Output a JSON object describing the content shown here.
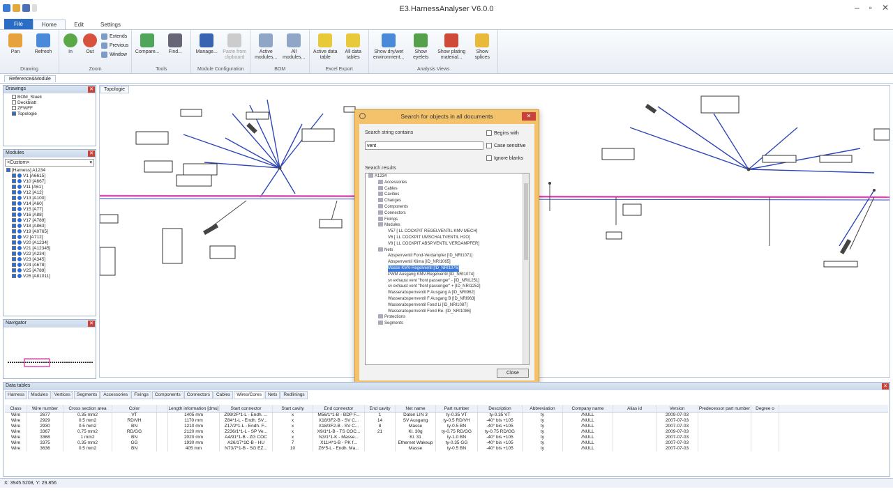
{
  "app": {
    "title": "E3.HarnessAnalyser V6.0.0"
  },
  "ribbon_tabs": [
    "File",
    "Home",
    "Edit",
    "Settings"
  ],
  "ribbon_groups": [
    {
      "label": "Drawing",
      "buttons": [
        "Pan",
        "Refresh"
      ]
    },
    {
      "label": "Zoom",
      "buttons": [
        "In",
        "Out"
      ],
      "small": [
        "Extends",
        "Previous",
        "Window"
      ]
    },
    {
      "label": "Tools",
      "buttons": [
        "Compare...",
        "Find..."
      ]
    },
    {
      "label": "Module Configuration",
      "buttons": [
        "Manage...",
        "Paste from clipboard"
      ]
    },
    {
      "label": "BOM",
      "buttons": [
        "Active modules...",
        "All modules..."
      ]
    },
    {
      "label": "Excel Export",
      "buttons": [
        "Active data table",
        "All data tables"
      ]
    },
    {
      "label": "Analysis Views",
      "buttons": [
        "Show dry/wet environment...",
        "Show eyelets",
        "Show plating material...",
        "Show splices"
      ]
    }
  ],
  "ref_tab": "Reference&Module",
  "drawings": {
    "title": "Drawings",
    "items": [
      "BOM_Stueli",
      "Deckblatt",
      "ZFWFF",
      "Topologie"
    ]
  },
  "modules": {
    "title": "Modules",
    "filter": "<Custom>",
    "root": "[Harness] A1234",
    "items": [
      "V1 [A6615]",
      "V10 [A667]",
      "V11 [A61]",
      "V12 [A12]",
      "V13 [A100]",
      "V14 [A60]",
      "V15 [A77]",
      "V16 [A88]",
      "V17 [A789]",
      "V18 [A863]",
      "V19 [A0765]",
      "V2 [A712]",
      "V20 [A1234]",
      "V21 [A12345]",
      "V22 [A234]",
      "V23 [A345]",
      "V24 [A678]",
      "V25 [A789]",
      "V26 [A81011]"
    ]
  },
  "navigator": {
    "title": "Navigator"
  },
  "canvas_tab": "Topologie",
  "dialog": {
    "title": "Search for objects in all documents",
    "search_label": "Search string contains",
    "search_value": "vent",
    "options": [
      "Begins with",
      "Case sensitive",
      "Ignore blanks"
    ],
    "results_label": "Search results",
    "results": [
      {
        "text": "A1234",
        "level": 0,
        "type": "root"
      },
      {
        "text": "Accessories",
        "level": 1,
        "type": "folder"
      },
      {
        "text": "Cables",
        "level": 1,
        "type": "folder"
      },
      {
        "text": "Cavities",
        "level": 1,
        "type": "folder"
      },
      {
        "text": "Changes",
        "level": 1,
        "type": "folder"
      },
      {
        "text": "Components",
        "level": 1,
        "type": "folder"
      },
      {
        "text": "Connectors",
        "level": 1,
        "type": "folder"
      },
      {
        "text": "Fixings",
        "level": 1,
        "type": "folder"
      },
      {
        "text": "Modules",
        "level": 1,
        "type": "folder"
      },
      {
        "text": "V57 [ LL COCKPIT REGELVENTIL KMV MECH]",
        "level": 2,
        "type": "item"
      },
      {
        "text": "V6 [ LL COCKPIT UMSCHALTVENTIL H2O]",
        "level": 2,
        "type": "item"
      },
      {
        "text": "V8 [ LL COCKPIT ABSP.VENTIL VERDAMPFER]",
        "level": 2,
        "type": "item"
      },
      {
        "text": "Nets",
        "level": 1,
        "type": "folder"
      },
      {
        "text": "Absperrventil Fond-Verdampfer [ID_NRI1071]",
        "level": 2,
        "type": "item"
      },
      {
        "text": "Absperrventil Klima [ID_NRI1065]",
        "level": 2,
        "type": "item"
      },
      {
        "text": "Masse KMV-Regelventil [ID_NRI1076]",
        "level": 2,
        "type": "item",
        "selected": true
      },
      {
        "text": "PWM Ausgang KMV-Regelventil [ID_NRI1074]",
        "level": 2,
        "type": "item"
      },
      {
        "text": "sv exhaust vent \"front passenger\" - [ID_NRI1251]",
        "level": 2,
        "type": "item"
      },
      {
        "text": "sv exhaust vent \"front passenger\" + [ID_NRI1252]",
        "level": 2,
        "type": "item"
      },
      {
        "text": "Wasserabsperrventil F Ausgang A [ID_NRI962]",
        "level": 2,
        "type": "item"
      },
      {
        "text": "Wasserabsperrventil F Ausgang B [ID_NRI963]",
        "level": 2,
        "type": "item"
      },
      {
        "text": "Wasserabsperrventil Fond Li [ID_NRI1087]",
        "level": 2,
        "type": "item"
      },
      {
        "text": "Wasserabsperrventil Fond Re. [ID_NRI1086]",
        "level": 2,
        "type": "item"
      },
      {
        "text": "Protections",
        "level": 1,
        "type": "folder"
      },
      {
        "text": "Segments",
        "level": 1,
        "type": "folder"
      }
    ],
    "close_label": "Close"
  },
  "data_tables": {
    "title": "Data tables",
    "tabs": [
      "Harness",
      "Modules",
      "Vertices",
      "Segments",
      "Accessories",
      "Fixings",
      "Components",
      "Connectors",
      "Cables",
      "Wires/Cores",
      "Nets",
      "Redlinings"
    ],
    "active_tab": "Wires/Cores",
    "columns": [
      "Class",
      "Wire number",
      "Cross section area",
      "Color",
      "",
      "Length information [dmu]",
      "Start connector",
      "Start cavity",
      "End connector",
      "End cavity",
      "Net name",
      "Part number",
      "Description",
      "Abbreviation",
      "Company name",
      "Alias id",
      "Version",
      "Predecessor part number",
      "Degree o"
    ],
    "rows": [
      [
        "Wire",
        "2677",
        "0.35 mm2",
        "VT",
        "",
        "1405 mm",
        "Z99/2F*1-L - Endh. ...",
        "x",
        "M56/1*1-B - BDP F...",
        "1",
        "Daten LIN 3",
        "ty-0.35 VT",
        "ty-0.35 VT",
        "ty",
        "/NULL",
        "",
        "2009-07-03",
        "",
        ""
      ],
      [
        "Wire",
        "2929",
        "0.5 mm2",
        "RD/VH",
        "",
        "1170 mm",
        "Z84*1-L - Endh. SV...",
        "x",
        "X18/3F2-B - SV C...",
        "14",
        "SV Ausgang",
        "ty-0.5 RD/VH",
        "-40° bis +105",
        "ty",
        "/NULL",
        "",
        "2007-07-03",
        "",
        ""
      ],
      [
        "Wire",
        "2930",
        "0.5 mm2",
        "BN",
        "",
        "1210 mm",
        "Z17/2*1-L - Endh. F...",
        "x",
        "X18/3F2-B - SV C...",
        "8",
        "Masse",
        "ty-0.5 BN",
        "-40° bis +105",
        "ty",
        "/NULL",
        "",
        "2007-07-03",
        "",
        ""
      ],
      [
        "Wire",
        "3367",
        "0.75 mm2",
        "RD/GG",
        "",
        "2120 mm",
        "Z236/1*1-L - SP Ve...",
        "x",
        "X9/1*1-B - TS COC...",
        "21",
        "Kl. 30g",
        "ty-0.75 RD/GG",
        "ty-0.75 RD/GG",
        "ty",
        "/NULL",
        "",
        "2009-07-03",
        "",
        ""
      ],
      [
        "Wire",
        "3368",
        "1 mm2",
        "BN",
        "",
        "2020 mm",
        "A4/91*1-B - ZG COC",
        "x",
        "N3/1*1-K - Masse...",
        "",
        "Kl. 31",
        "ty-1.0 BN",
        "-40° bis +105",
        "ty",
        "/NULL",
        "",
        "2007-07-03",
        "",
        ""
      ],
      [
        "Wire",
        "3375",
        "0.35 mm2",
        "GG",
        "",
        "1930 mm",
        "A26/17*1C-B - HU",
        "7",
        "X11/4*1-B - PK f...",
        "",
        "Ethernet Wakeup",
        "ty-0.35 GG",
        "-40° bis +105",
        "ty",
        "/NULL",
        "",
        "2007-07-03",
        "",
        ""
      ],
      [
        "Wire",
        "3636",
        "0.5 mm2",
        "BN",
        "",
        "405 mm",
        "N73/7*1-B - SG EZ...",
        "10",
        "Z6*5-L - Endh. Ma...",
        "",
        "Masse",
        "ty-0.5 BN",
        "-40° bis +105",
        "ty",
        "/NULL",
        "",
        "2007-07-03",
        "",
        ""
      ]
    ]
  },
  "status": {
    "coords": "X: 3945.5208, Y: 29.856"
  },
  "colors": {
    "accent": "#2b6cc4",
    "dialog": "#f3c26a",
    "wire_pink": "#d94fb0",
    "wire_blue": "#2d47b8"
  }
}
